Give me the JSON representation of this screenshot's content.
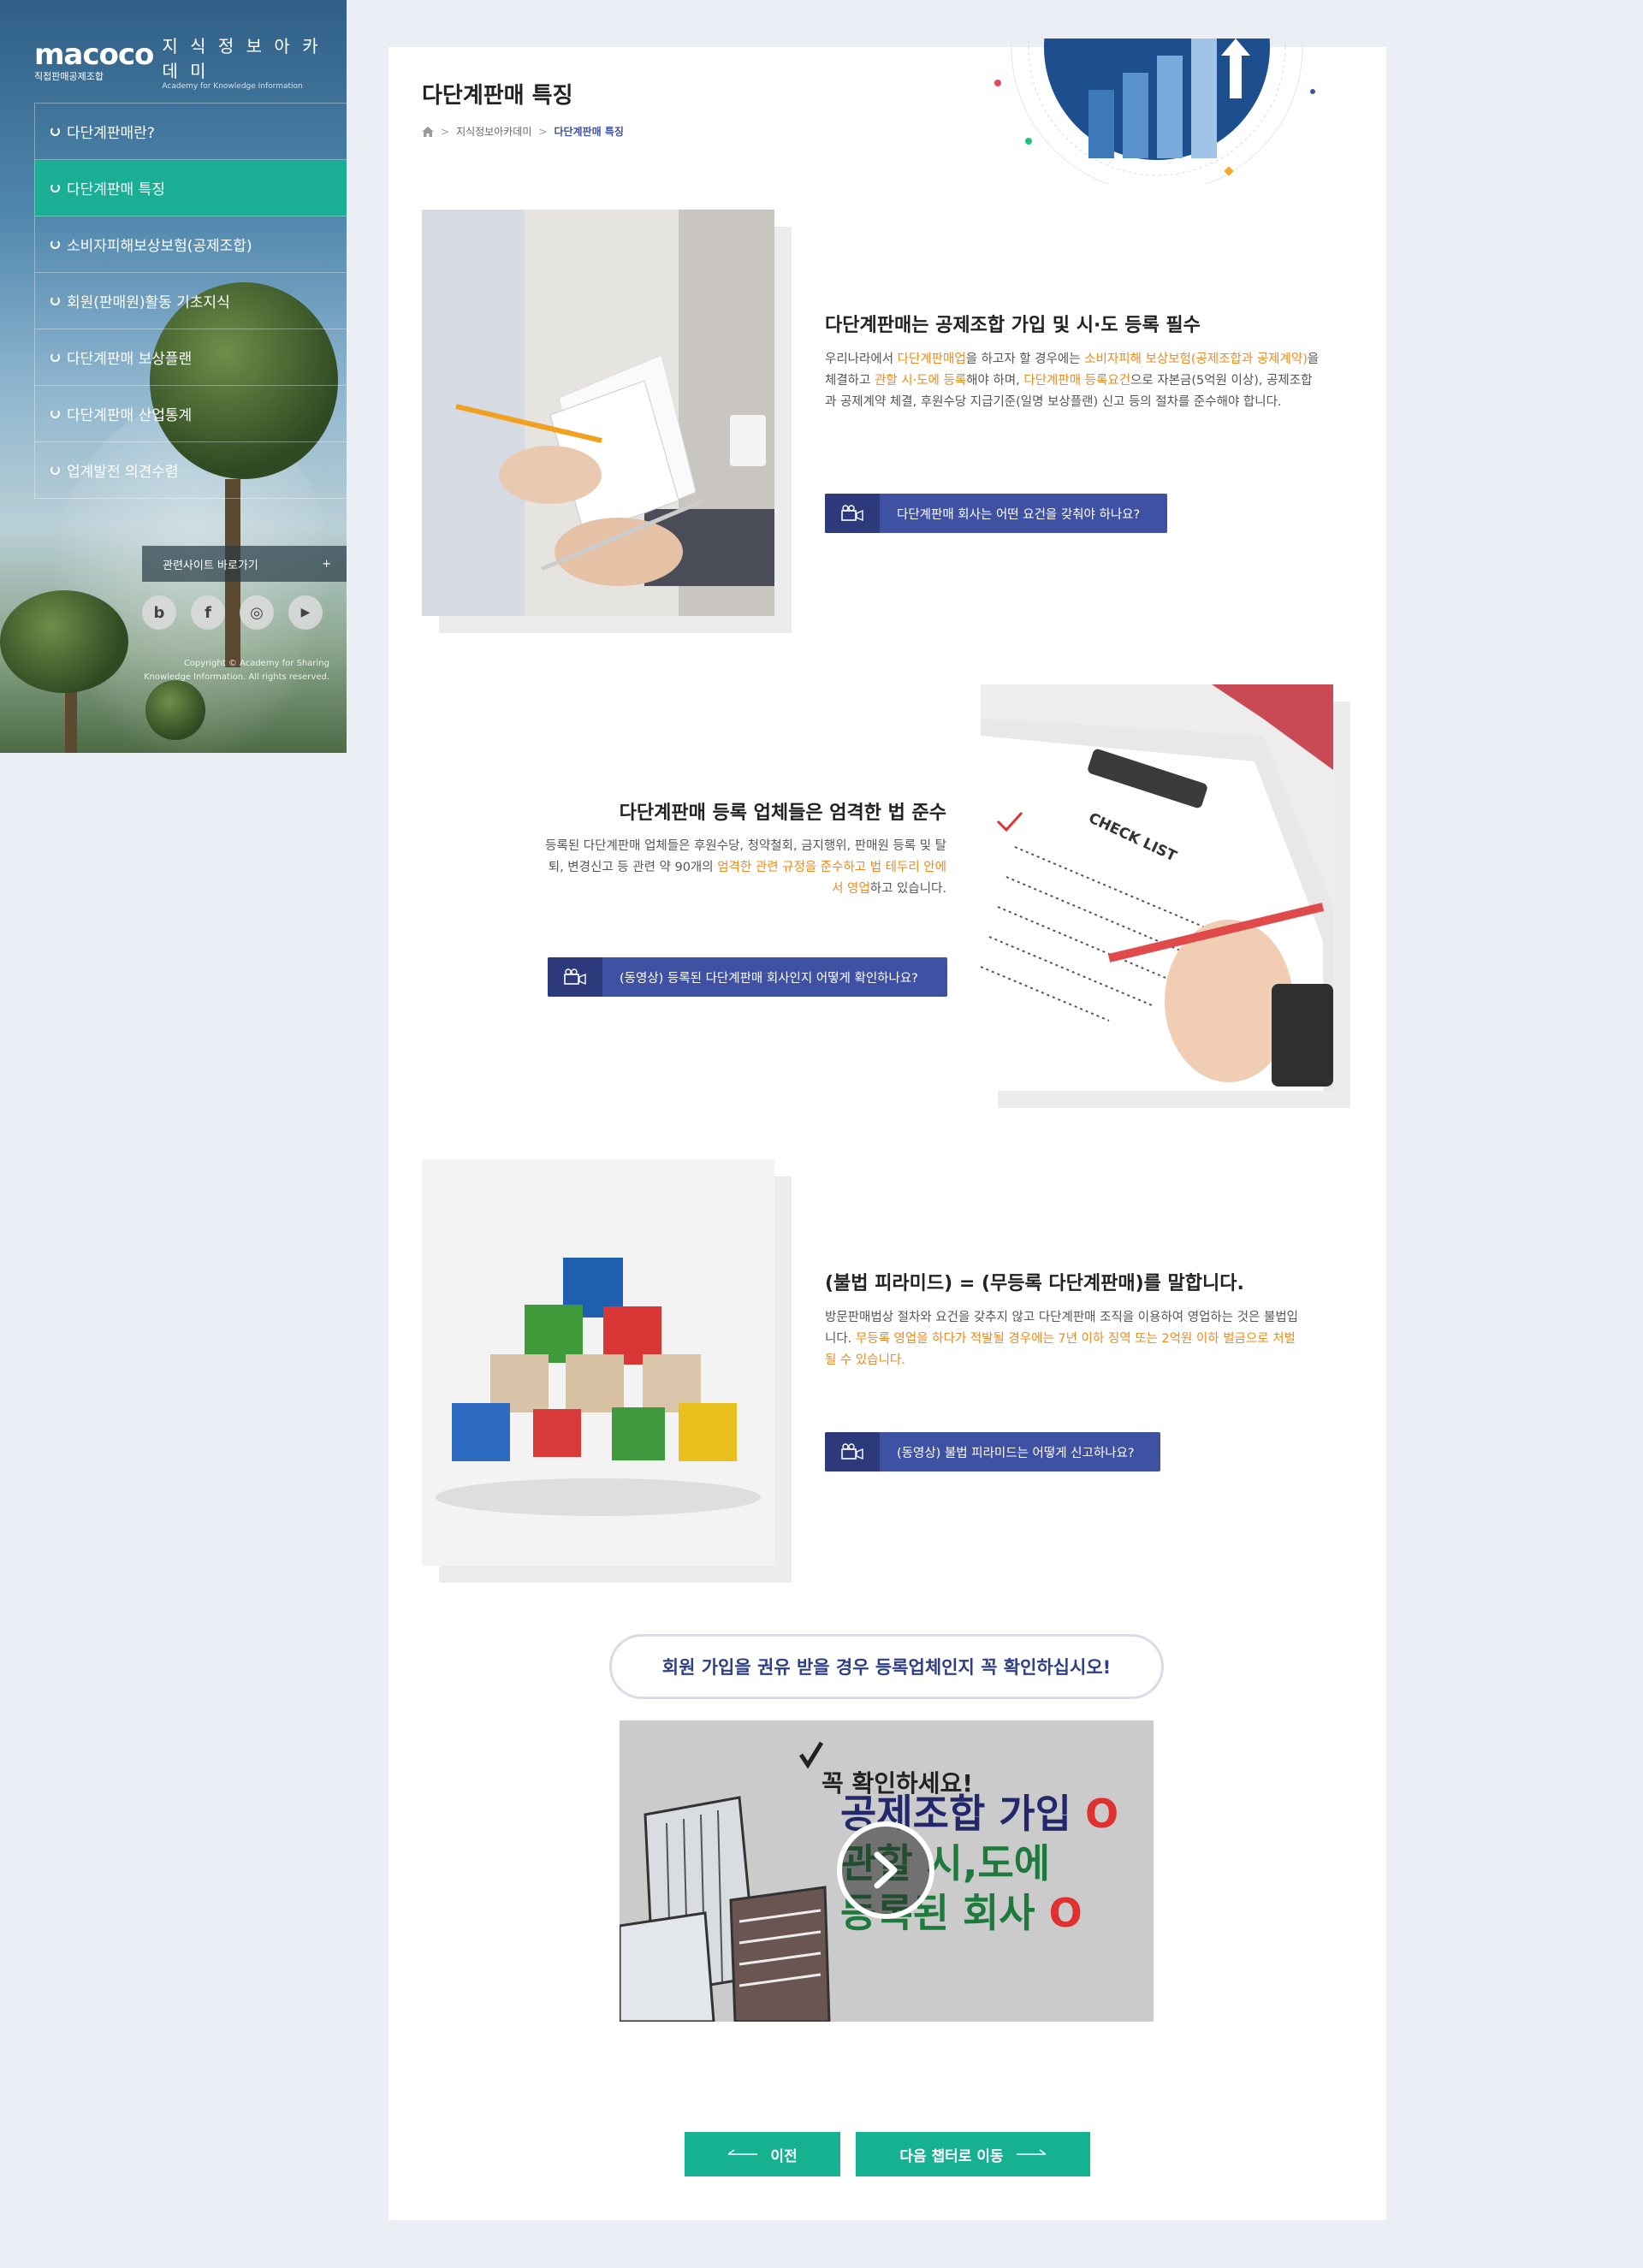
{
  "brand": {
    "logo_mark": "macoco",
    "logo_sub": "직접판매공제조합",
    "academy_name": "지 식 정 보 아 카 데 미",
    "academy_en": "Academy for Knowledge Information"
  },
  "sidebar": {
    "items": [
      {
        "label": "다단계판매란?",
        "active": false
      },
      {
        "label": "다단계판매 특징",
        "active": true
      },
      {
        "label": "소비자피해보상보험(공제조합)",
        "active": false
      },
      {
        "label": "회원(판매원)활동 기초지식",
        "active": false
      },
      {
        "label": "다단계판매 보상플랜",
        "active": false
      },
      {
        "label": "다단계판매 산업통계",
        "active": false
      },
      {
        "label": "업계발전 의견수렴",
        "active": false
      }
    ],
    "related_sites": "관련사이트 바로가기",
    "related_plus": "+",
    "socials": [
      {
        "name": "blog",
        "glyph": "b"
      },
      {
        "name": "facebook",
        "glyph": "f"
      },
      {
        "name": "instagram",
        "glyph": "◎"
      },
      {
        "name": "youtube",
        "glyph": "▶"
      }
    ],
    "copyright_line1": "Copyright © Academy for Sharing",
    "copyright_line2": "Knowledge Information. All rights reserved."
  },
  "header": {
    "title": "다단계판매 특징",
    "breadcrumb": [
      "지식정보아카데미",
      "다단계판매 특징"
    ],
    "breadcrumb_sep": ">"
  },
  "sections": [
    {
      "title": "다단계판매는 공제조합 가입 및 시·도 등록 필수",
      "text_parts": [
        {
          "t": "우리나라에서 ",
          "hl": false
        },
        {
          "t": "다단계판매업",
          "hl": true
        },
        {
          "t": "을 하고자 할 경우에는 ",
          "hl": false
        },
        {
          "t": "소비자피해 보상보험(공제조합과 공제계약)",
          "hl": true
        },
        {
          "t": "을 체결하고 ",
          "hl": false
        },
        {
          "t": "관할 시·도에 등록",
          "hl": true
        },
        {
          "t": "해야 하며, ",
          "hl": false
        },
        {
          "t": "다단계판매 등록요건",
          "hl": true
        },
        {
          "t": "으로 자본금(5억원 이상), 공제조합과 공제계약 체결, 후원수당 지급기준(일명 보상플랜) 신고 등의 절차를 준수해야 합니다.",
          "hl": false
        }
      ],
      "button": "다단계판매 회사는 어떤 요건을 갖춰야 하나요?"
    },
    {
      "title": "다단계판매 등록 업체들은 엄격한 법 준수",
      "text_parts": [
        {
          "t": "등록된 다단계판매 업체들은 후원수당, 청약철회, 금지행위, 판매원 등록 및 탈퇴, 변경신고 등 관련 약 90개의 ",
          "hl": false
        },
        {
          "t": "엄격한 관련 규정을 준수하고 법 테두리 안에서 영업",
          "hl": true
        },
        {
          "t": "하고 있습니다.",
          "hl": false
        }
      ],
      "button": "(동영상) 등록된 다단계판매 회사인지 어떻게 확인하나요?"
    },
    {
      "title": "(불법 피라미드) = (무등록 다단계판매)를 말합니다.",
      "text_parts": [
        {
          "t": "방문판매법상 절차와 요건을 갖추지 않고 다단계판매 조직을 이용하여 영업하는 것은 불법입니다. ",
          "hl": false
        },
        {
          "t": "무등록 영업을 하다가 적발될 경우에는 7년 이하 징역 또는 2억원 이하 벌금으로 처벌될 수 있습니다.",
          "hl": true
        }
      ],
      "button": "(동영상) 불법 피라미드는 어떻게 신고하나요?"
    }
  ],
  "photos": {
    "checklist_label": "CHECK LIST"
  },
  "notice": "회원 가입을 권유 받을 경우 등록업체인지 꼭 확인하십시오!",
  "video": {
    "check_text": "꼭 확인하세요!",
    "line1": "공제조합 가입",
    "line2": "관할 시,도에",
    "line3": "등록된 회사",
    "mark": "O"
  },
  "pager": {
    "prev": "이전",
    "next": "다음 챕터로 이동"
  },
  "colors": {
    "accent_green": "#1aae94",
    "button_blue": "#3f51a3",
    "highlight_orange": "#f08a1c",
    "page_bg": "#ebeef5"
  }
}
